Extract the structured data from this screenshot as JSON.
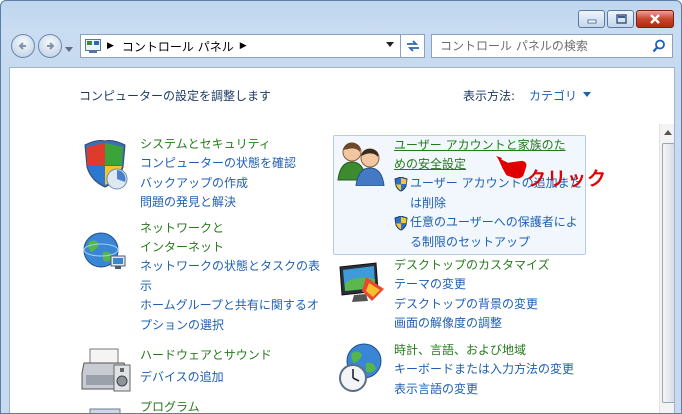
{
  "window": {
    "minimize_icon": "minimize-icon",
    "maximize_icon": "maximize-icon",
    "close_icon": "close-icon"
  },
  "address_bar": {
    "breadcrumb": "コントロール パネル",
    "control_panel_icon": "control-panel-icon"
  },
  "search": {
    "placeholder": "コントロール パネルの検索"
  },
  "header": {
    "title": "コンピューターの設定を調整します",
    "view_by_label": "表示方法:",
    "view_by_value": "カテゴリ"
  },
  "categories": [
    {
      "title": "システムとセキュリティ",
      "icon": "system-security-shield-icon",
      "links": [
        "コンピューターの状態を確認",
        "バックアップの作成",
        "問題の発見と解決"
      ]
    },
    {
      "title_line1": "ネットワークと",
      "title_line2": "インターネット",
      "icon": "network-globe-icon",
      "links": [
        "ネットワークの状態とタスクの表",
        "示",
        "ホームグループと共有に関するオ",
        "プションの選択"
      ]
    },
    {
      "title": "ハードウェアとサウンド",
      "icon": "printer-icon",
      "links": [
        "デバイスの追加"
      ]
    },
    {
      "title": "プログラム",
      "icon": "programs-icon",
      "links": []
    },
    {
      "title_line1": "ユーザー アカウントと家族のた",
      "title_line2": "めの安全設定",
      "icon": "users-icon",
      "links": [
        {
          "line1": "ユーザー アカウントの追加また",
          "line2": "は削除"
        },
        {
          "line1": "任意のユーザーへの保護者によ",
          "line2": "る制限のセットアップ"
        }
      ]
    },
    {
      "title": "デスクトップのカスタマイズ",
      "icon": "monitor-icon",
      "links": [
        "テーマの変更",
        "デスクトップの背景の変更",
        "画面の解像度の調整"
      ]
    },
    {
      "title": "時計、言語、および地域",
      "icon": "clock-globe-icon",
      "links": [
        "キーボードまたは入力方法の変更",
        "表示言語の変更"
      ]
    }
  ],
  "annotation": {
    "text": "クリック",
    "color": "#e00000"
  },
  "colors": {
    "category_title": "#267a1d",
    "link": "#1e5fb4",
    "highlight_border": "#b2cdea"
  }
}
